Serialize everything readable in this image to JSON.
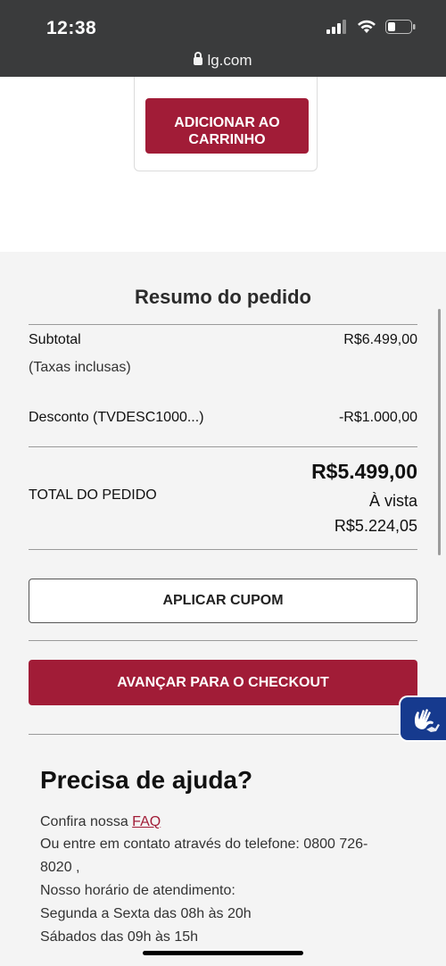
{
  "status_bar": {
    "time": "12:38"
  },
  "browser": {
    "url": "lg.com"
  },
  "card": {
    "add_button": "ADICIONAR AO CARRINHO"
  },
  "summary": {
    "title": "Resumo do pedido",
    "subtotal_label": "Subtotal",
    "subtotal_value": "R$6.499,00",
    "tax_note": "(Taxas inclusas)",
    "discount_label": "Desconto (TVDESC1000...)",
    "discount_value": "-R$1.000,00",
    "total_label": "TOTAL DO PEDIDO",
    "total_value": "R$5.499,00",
    "cash_label": "À vista",
    "cash_value": "R$5.224,05"
  },
  "actions": {
    "coupon": "APLICAR CUPOM",
    "checkout": "AVANÇAR PARA O CHECKOUT"
  },
  "help": {
    "title": "Precisa de ajuda?",
    "faq_prefix": "Confira nossa",
    "faq_link": "FAQ",
    "contact_line1": "Ou entre em contato através do telefone: 0800 726-",
    "contact_line2": "8020 ,",
    "hours_title": "Nosso horário de atendimento:",
    "hours_weekdays": "Segunda a Sexta das 08h às 20h",
    "hours_saturday": "Sábados das 09h às 15h"
  },
  "colors": {
    "brand": "#a11c37",
    "accessibility": "#163a8e"
  },
  "icons": [
    "lock-icon",
    "signal-icon",
    "wifi-icon",
    "battery-icon",
    "sign-language-icon"
  ]
}
